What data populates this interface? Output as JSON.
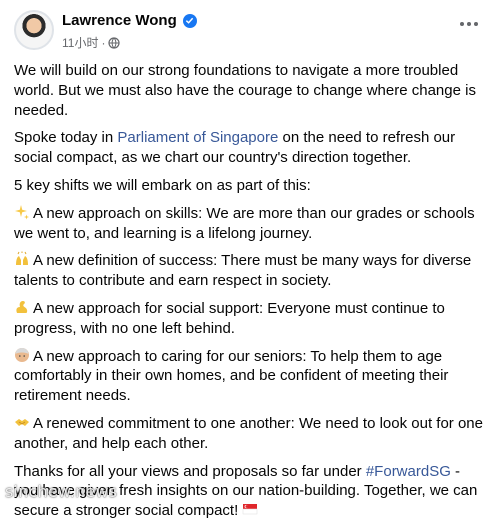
{
  "post": {
    "author": "Lawrence Wong",
    "time": "11小时",
    "separator": "·",
    "paragraphs": {
      "p1": "We will build on our strong foundations to navigate a more troubled world. But we must also have the courage to change where change is needed.",
      "p2_before": "Spoke today in ",
      "p2_link": "Parliament of Singapore",
      "p2_after": " on the need to refresh our social compact, as we chart our country's direction together.",
      "p3": "5 key shifts we will embark on as part of this:",
      "shift1": "A new approach on skills: We are more than our grades or schools we went to, and learning is a lifelong journey.",
      "shift2": "A new definition of success: There must be many ways for diverse talents to contribute and earn respect in society.",
      "shift3": "A new approach for social support: Everyone must continue to progress, with no one left behind.",
      "shift4": "A new approach to caring for our seniors: To help them to age comfortably in their own homes, and be confident of meeting their retirement needs.",
      "shift5": "A renewed commitment to one another: We need to look out for one another, and help each other.",
      "p_final_before": "Thanks for all your views and proposals so far under ",
      "p_final_link": "#ForwardSG",
      "p_final_after": " - you have given fresh insights on our nation-building. Together, we can secure a stronger social compact!"
    },
    "emoji_icons": [
      "sparkles-icon",
      "raised-hands-icon",
      "flexed-biceps-icon",
      "older-person-icon",
      "handshake-icon",
      "singapore-flag-icon"
    ]
  },
  "watermark": "sinchew.news",
  "colors": {
    "link": "#385898",
    "verified": "#1877f2",
    "meta": "#65676b"
  }
}
